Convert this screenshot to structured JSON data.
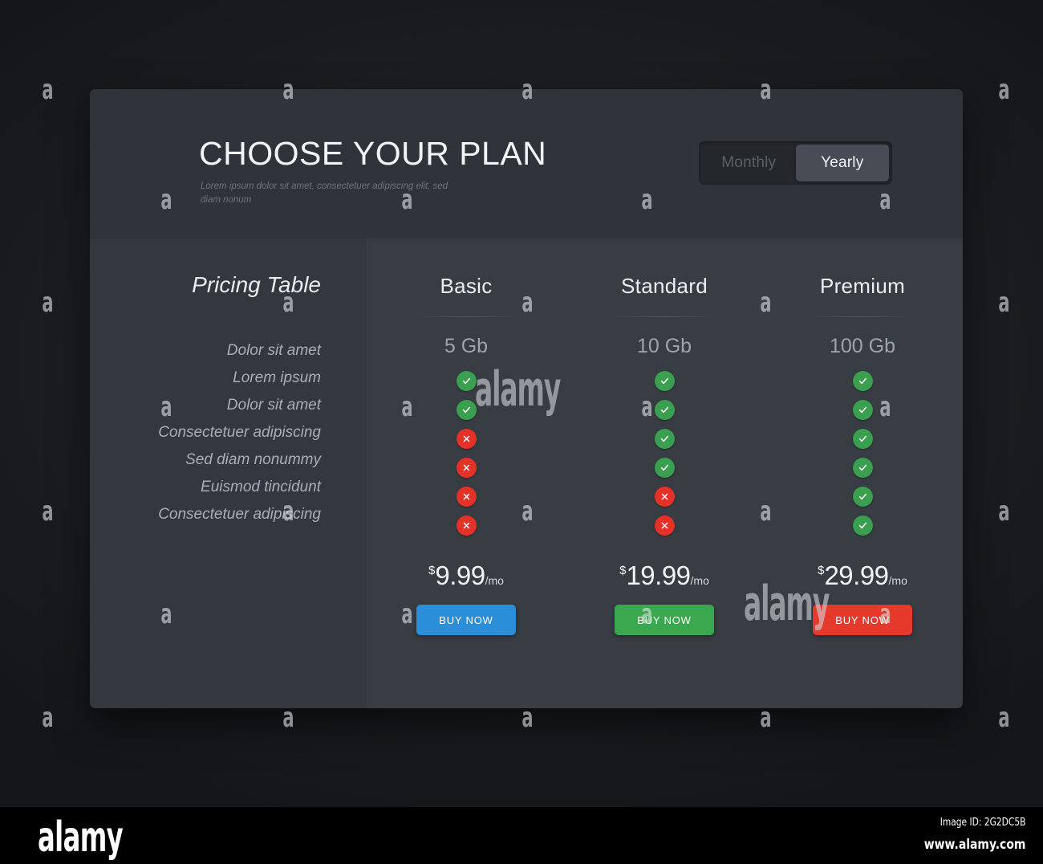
{
  "header": {
    "title": "CHOOSE YOUR PLAN",
    "subtitle": "Lorem ipsum dolor sit amet, consectetuer adipiscing elit, sed diam nonum",
    "toggle": {
      "monthly_label": "Monthly",
      "yearly_label": "Yearly",
      "selected": "Yearly"
    }
  },
  "sidebar": {
    "title": "Pricing Table",
    "features": [
      "Dolor sit amet",
      "Lorem ipsum",
      "Dolor sit amet",
      "Consectetuer adipiscing",
      "Sed diam nonummy",
      "Euismod tincidunt",
      "Consectetuer adipiscing"
    ]
  },
  "plans": [
    {
      "name": "Basic",
      "quota": "5 Gb",
      "marks": [
        "yes",
        "yes",
        "no",
        "no",
        "no",
        "no"
      ],
      "currency": "$",
      "amount": "9.99",
      "period": "/mo",
      "buy_label": "BUY NOW",
      "accent": "#2a8fd8"
    },
    {
      "name": "Standard",
      "quota": "10 Gb",
      "marks": [
        "yes",
        "yes",
        "yes",
        "yes",
        "no",
        "no"
      ],
      "currency": "$",
      "amount": "19.99",
      "period": "/mo",
      "buy_label": "BUY NOW",
      "accent": "#3aa84f"
    },
    {
      "name": "Premium",
      "quota": "100 Gb",
      "marks": [
        "yes",
        "yes",
        "yes",
        "yes",
        "yes",
        "yes"
      ],
      "currency": "$",
      "amount": "29.99",
      "period": "/mo",
      "buy_label": "BUY NOW",
      "accent": "#e5392c"
    }
  ],
  "colors": {
    "yes": "#3aa04f",
    "no": "#e53228",
    "card": "#33373d",
    "header_panel": "#2f333a",
    "sidebar": "#34383e",
    "plans_panel": "#383c43",
    "page_background": "#1b1d20"
  },
  "watermark": {
    "glyph": "a",
    "brand": "alamy"
  },
  "footer": {
    "logo": "alamy",
    "image_id": "Image ID: 2G2DC5B",
    "url": "www.alamy.com"
  }
}
